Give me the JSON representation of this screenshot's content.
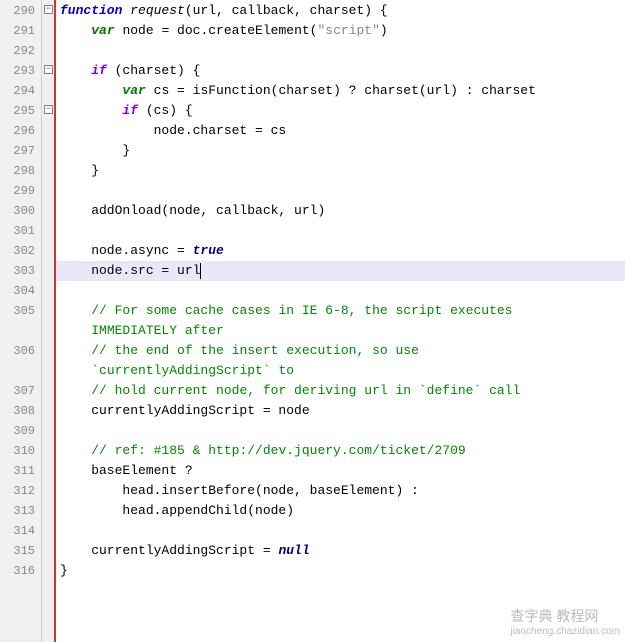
{
  "lines": [
    {
      "num": "290",
      "fold": "minus",
      "tokens": [
        {
          "t": "function ",
          "c": "kw-blue"
        },
        {
          "t": "request",
          "c": "fn-name"
        },
        {
          "t": "(url, callback, charset) {",
          "c": "text-black"
        }
      ]
    },
    {
      "num": "291",
      "tokens": [
        {
          "t": "    ",
          "c": ""
        },
        {
          "t": "var ",
          "c": "kw-green"
        },
        {
          "t": "node = doc.createElement(",
          "c": "text-black"
        },
        {
          "t": "\"script\"",
          "c": "text-string"
        },
        {
          "t": ")",
          "c": "text-black"
        }
      ]
    },
    {
      "num": "292",
      "tokens": []
    },
    {
      "num": "293",
      "fold": "minus",
      "tokens": [
        {
          "t": "    ",
          "c": ""
        },
        {
          "t": "if ",
          "c": "kw-purple"
        },
        {
          "t": "(charset) {",
          "c": "text-black"
        }
      ]
    },
    {
      "num": "294",
      "tokens": [
        {
          "t": "        ",
          "c": ""
        },
        {
          "t": "var ",
          "c": "kw-green"
        },
        {
          "t": "cs = isFunction(charset) ? charset(url) : charset",
          "c": "text-black"
        }
      ]
    },
    {
      "num": "295",
      "fold": "minus",
      "tokens": [
        {
          "t": "        ",
          "c": ""
        },
        {
          "t": "if ",
          "c": "kw-purple"
        },
        {
          "t": "(cs) {",
          "c": "text-black"
        }
      ]
    },
    {
      "num": "296",
      "tokens": [
        {
          "t": "            node.charset = cs",
          "c": "text-black"
        }
      ]
    },
    {
      "num": "297",
      "tokens": [
        {
          "t": "        }",
          "c": "text-black"
        }
      ]
    },
    {
      "num": "298",
      "tokens": [
        {
          "t": "    }",
          "c": "text-black"
        }
      ]
    },
    {
      "num": "299",
      "tokens": []
    },
    {
      "num": "300",
      "tokens": [
        {
          "t": "    addOnload(node, callback, url)",
          "c": "text-black"
        }
      ]
    },
    {
      "num": "301",
      "tokens": []
    },
    {
      "num": "302",
      "tokens": [
        {
          "t": "    node.async = ",
          "c": "text-black"
        },
        {
          "t": "true",
          "c": "kw-navy"
        }
      ]
    },
    {
      "num": "303",
      "highlighted": true,
      "cursor": true,
      "tokens": [
        {
          "t": "    node.src = url",
          "c": "text-black"
        }
      ]
    },
    {
      "num": "304",
      "tokens": []
    },
    {
      "num": "305",
      "tokens": [
        {
          "t": "    ",
          "c": ""
        },
        {
          "t": "// For some cache cases in IE 6-8, the script executes",
          "c": "text-comment"
        }
      ]
    },
    {
      "num": "",
      "tokens": [
        {
          "t": "    ",
          "c": ""
        },
        {
          "t": "IMMEDIATELY after",
          "c": "text-comment"
        }
      ]
    },
    {
      "num": "306",
      "tokens": [
        {
          "t": "    ",
          "c": ""
        },
        {
          "t": "// the end of the insert execution, so use",
          "c": "text-comment"
        }
      ]
    },
    {
      "num": "",
      "tokens": [
        {
          "t": "    ",
          "c": ""
        },
        {
          "t": "`currentlyAddingScript` to",
          "c": "text-comment"
        }
      ]
    },
    {
      "num": "307",
      "tokens": [
        {
          "t": "    ",
          "c": ""
        },
        {
          "t": "// hold current node, for deriving url in `define` call",
          "c": "text-comment"
        }
      ]
    },
    {
      "num": "308",
      "tokens": [
        {
          "t": "    currentlyAddingScript = node",
          "c": "text-black"
        }
      ]
    },
    {
      "num": "309",
      "tokens": []
    },
    {
      "num": "310",
      "tokens": [
        {
          "t": "    ",
          "c": ""
        },
        {
          "t": "// ref: #185 & http://dev.jquery.com/ticket/2709",
          "c": "text-comment"
        }
      ]
    },
    {
      "num": "311",
      "tokens": [
        {
          "t": "    baseElement ?",
          "c": "text-black"
        }
      ]
    },
    {
      "num": "312",
      "tokens": [
        {
          "t": "        head.insertBefore(node, baseElement) :",
          "c": "text-black"
        }
      ]
    },
    {
      "num": "313",
      "tokens": [
        {
          "t": "        head.appendChild(node)",
          "c": "text-black"
        }
      ]
    },
    {
      "num": "314",
      "tokens": []
    },
    {
      "num": "315",
      "tokens": [
        {
          "t": "    currentlyAddingScript = ",
          "c": "text-black"
        },
        {
          "t": "null",
          "c": "kw-navy"
        }
      ]
    },
    {
      "num": "316",
      "tokens": [
        {
          "t": "}",
          "c": "text-black"
        }
      ]
    }
  ],
  "watermark": {
    "cn": "查字典 教程网",
    "url": "jiaocheng.chazidian.com"
  }
}
